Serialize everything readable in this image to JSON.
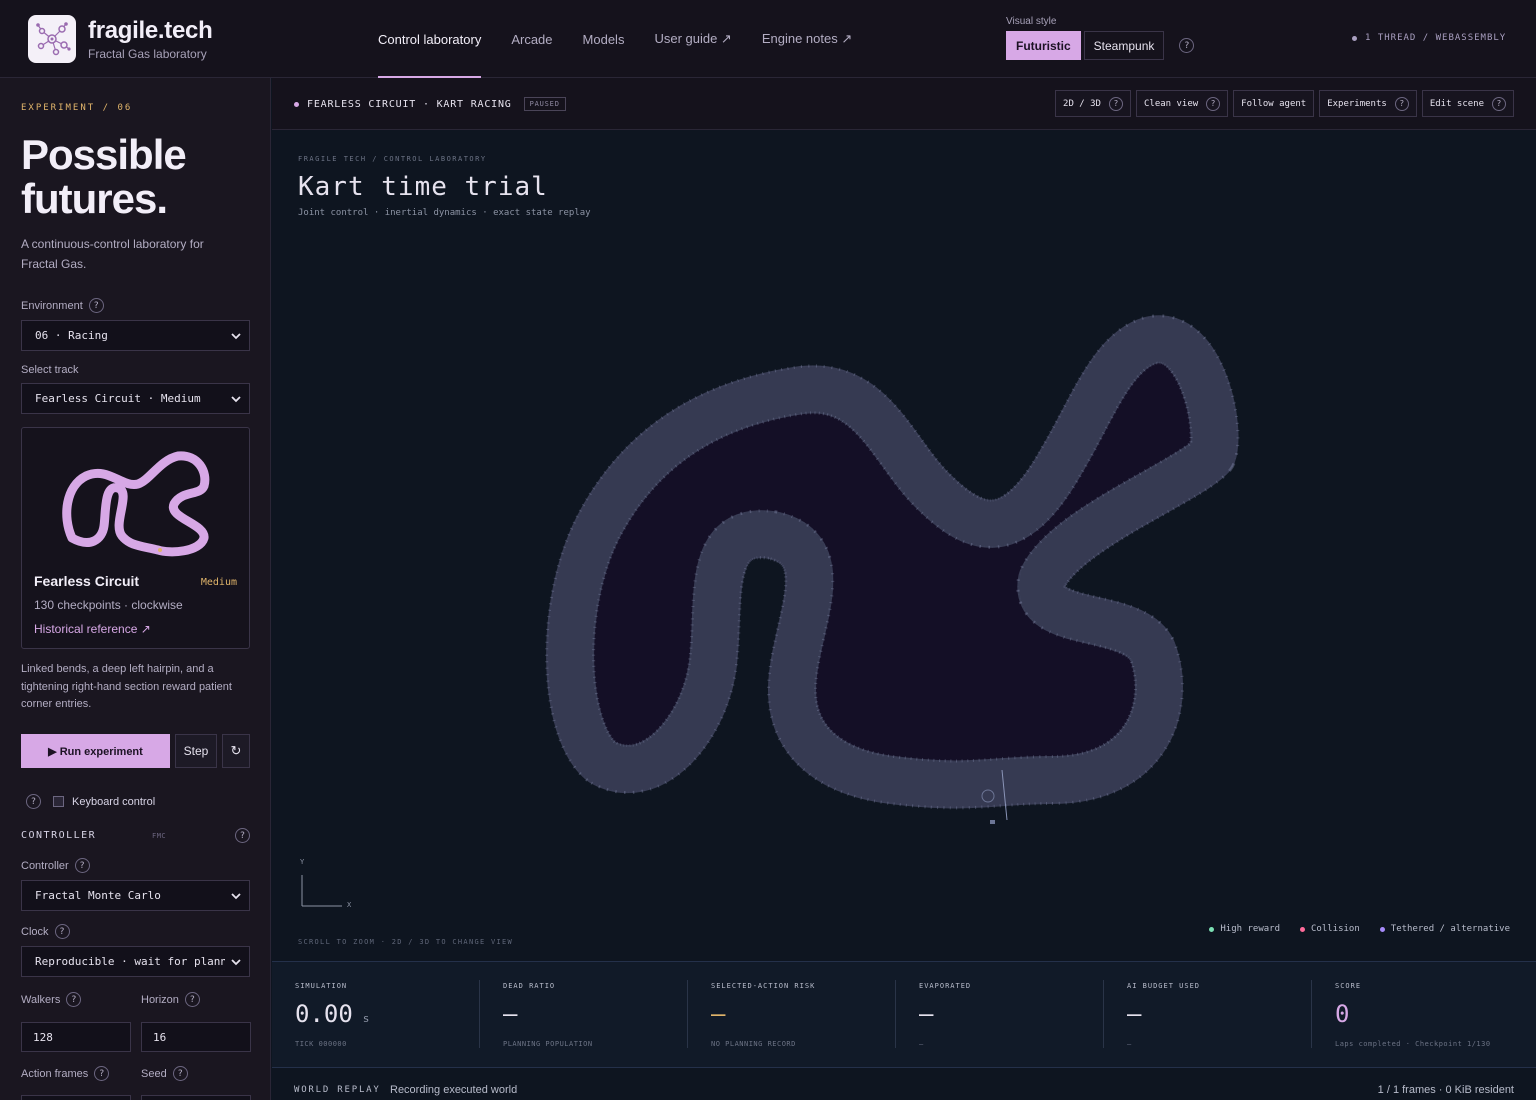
{
  "brand": {
    "name": "fragile.tech",
    "subtitle": "Fractal Gas laboratory"
  },
  "nav": [
    {
      "label": "Control laboratory",
      "active": true
    },
    {
      "label": "Arcade"
    },
    {
      "label": "Models"
    },
    {
      "label": "User guide ↗"
    },
    {
      "label": "Engine notes ↗"
    }
  ],
  "visual_style": {
    "label": "Visual style",
    "options": [
      "Futuristic",
      "Steampunk"
    ],
    "selected": "Futuristic"
  },
  "thread_status": "1 THREAD / WEBASSEMBLY",
  "sidebar": {
    "eyebrow": "EXPERIMENT / 06",
    "headline_line1": "Possible",
    "headline_line2": "futures.",
    "intro": "A continuous-control laboratory for Fractal Gas.",
    "environment_label": "Environment",
    "environment_value": "06 · Racing",
    "track_label": "Select track",
    "track_value": "Fearless Circuit · Medium",
    "track_card": {
      "name": "Fearless Circuit",
      "difficulty": "Medium",
      "meta": "130 checkpoints · clockwise",
      "link": "Historical reference ↗"
    },
    "description": "Linked bends, a deep left hairpin, and a tightening right-hand section reward patient corner entries.",
    "run_label": "▶ Run experiment",
    "step_label": "Step",
    "reset_glyph": "↻",
    "keyboard_label": "Keyboard control",
    "controller_section": "CONTROLLER",
    "controller_tag": "FMC",
    "controller_label": "Controller",
    "controller_value": "Fractal Monte Carlo",
    "clock_label": "Clock",
    "clock_value": "Reproducible · wait for plann",
    "walkers_label": "Walkers",
    "walkers_value": "128",
    "horizon_label": "Horizon",
    "horizon_value": "16",
    "action_frames_label": "Action frames",
    "seed_label": "Seed"
  },
  "main_header": {
    "title": "FEARLESS CIRCUIT · KART RACING",
    "status": "PAUSED",
    "actions": [
      {
        "label": "2D / 3D",
        "help": true
      },
      {
        "label": "Clean view",
        "help": true
      },
      {
        "label": "Follow agent",
        "help": false
      },
      {
        "label": "Experiments",
        "help": true
      },
      {
        "label": "Edit scene",
        "help": true
      }
    ]
  },
  "stage": {
    "eyebrow": "FRAGILE TECH / CONTROL LABORATORY",
    "title": "Kart time trial",
    "subtitle": "Joint control · inertial dynamics · exact state replay",
    "axis_y": "Y",
    "axis_x": "X",
    "hint": "SCROLL TO ZOOM · 2D / 3D TO CHANGE VIEW",
    "legend": [
      {
        "label": "High reward",
        "color": "#7ce0b4"
      },
      {
        "label": "Collision",
        "color": "#ff6b9a"
      },
      {
        "label": "Tethered / alternative",
        "color": "#a78bfa"
      }
    ]
  },
  "stats": [
    {
      "key": "SIMULATION",
      "value": "0.00",
      "unit": "s",
      "sub": "TICK 000000",
      "color": "#e6e2ee"
    },
    {
      "key": "DEAD RATIO",
      "value": "—",
      "unit": "",
      "sub": "PLANNING POPULATION",
      "color": "#e6e2ee"
    },
    {
      "key": "SELECTED-ACTION RISK",
      "value": "—",
      "unit": "",
      "sub": "NO PLANNING RECORD",
      "color": "#e0b46a"
    },
    {
      "key": "EVAPORATED",
      "value": "—",
      "unit": "",
      "sub": "—",
      "color": "#e6e2ee"
    },
    {
      "key": "AI BUDGET USED",
      "value": "—",
      "unit": "",
      "sub": "—",
      "color": "#e6e2ee"
    },
    {
      "key": "SCORE",
      "value": "0",
      "unit": "",
      "sub": "Laps completed · Checkpoint 1/130",
      "color": "#d7a8e6"
    }
  ],
  "replay": {
    "label": "WORLD REPLAY",
    "status": "Recording executed world",
    "frames": "1 / 1 frames · 0 KiB resident"
  },
  "help_glyph": "?",
  "colors": {
    "accent": "#d7a8e6",
    "warning": "#e0b46a",
    "track": "#3a3d55",
    "track_edge": "#8b95b8"
  }
}
